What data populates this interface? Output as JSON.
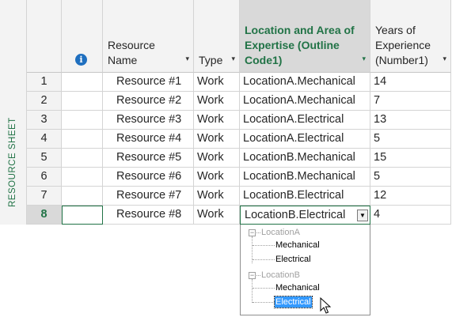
{
  "sidebar": {
    "label": "RESOURCE SHEET"
  },
  "columns": {
    "info": "i",
    "resource_name": "Resource Name",
    "type": "Type",
    "location": "Location and Area of Expertise (Outline Code1)",
    "years": "Years of Experience (Number1)",
    "sort_arrow": "▾"
  },
  "rows": [
    {
      "num": "1",
      "name": "Resource #1",
      "type": "Work",
      "location": "LocationA.Mechanical",
      "years": "14"
    },
    {
      "num": "2",
      "name": "Resource #2",
      "type": "Work",
      "location": "LocationA.Mechanical",
      "years": "7"
    },
    {
      "num": "3",
      "name": "Resource #3",
      "type": "Work",
      "location": "LocationA.Electrical",
      "years": "13"
    },
    {
      "num": "4",
      "name": "Resource #4",
      "type": "Work",
      "location": "LocationA.Electrical",
      "years": "5"
    },
    {
      "num": "5",
      "name": "Resource #5",
      "type": "Work",
      "location": "LocationB.Mechanical",
      "years": "15"
    },
    {
      "num": "6",
      "name": "Resource #6",
      "type": "Work",
      "location": "LocationB.Mechanical",
      "years": "5"
    },
    {
      "num": "7",
      "name": "Resource #7",
      "type": "Work",
      "location": "LocationB.Electrical",
      "years": "12"
    },
    {
      "num": "8",
      "name": "Resource #8",
      "type": "Work",
      "location": "LocationB.Electrical",
      "years": "4"
    }
  ],
  "dropdown": {
    "button_glyph": "▼",
    "location_a": "LocationA",
    "location_a_children": [
      "Mechanical",
      "Electrical"
    ],
    "location_b": "LocationB",
    "location_b_children": [
      "Mechanical",
      "Electrical"
    ],
    "selected": "Electrical",
    "collapse_glyph": "−"
  },
  "colors": {
    "accent": "#217346",
    "selection": "#3399ff",
    "info_icon": "#1f6fbf"
  }
}
